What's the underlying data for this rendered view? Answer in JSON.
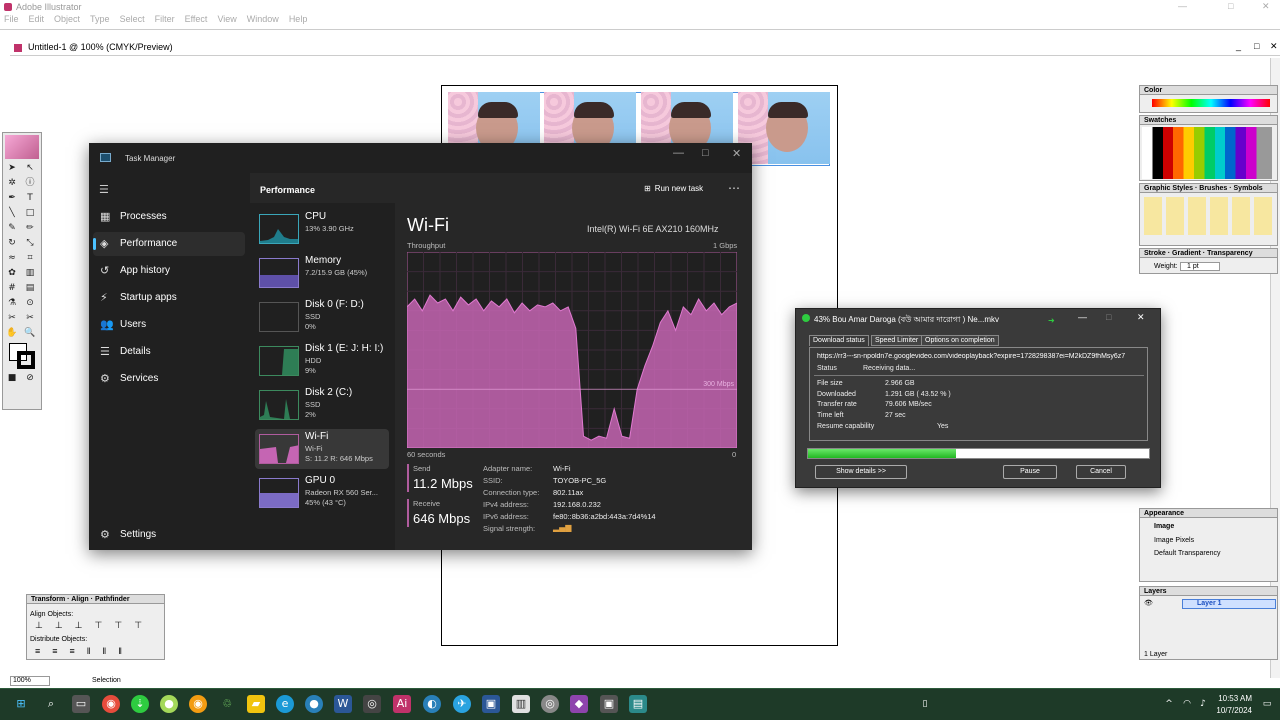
{
  "illustrator": {
    "title": "Adobe Illustrator",
    "menu": [
      "File",
      "Edit",
      "Object",
      "Type",
      "Select",
      "Filter",
      "Effect",
      "View",
      "Window",
      "Help"
    ],
    "doc_tab": "Untitled-1 @ 100% (CMYK/Preview)",
    "zoom": "100%",
    "status_tool": "Selection",
    "panels": {
      "color": "Color",
      "swatches": "Swatches",
      "graphic_styles": "Graphic Styles",
      "brushes": "Brushes",
      "symbols": "Symbols",
      "stroke": "Stroke",
      "gradient": "Gradient",
      "transparency": "Transparency",
      "weight_label": "Weight:",
      "weight_value": "1 pt",
      "appearance": "Appearance",
      "appearance_image": "Image",
      "appearance_pixels": "Image Pixels",
      "appearance_transparency": "Default Transparency",
      "layers": "Layers",
      "layer1": "Layer 1",
      "layer_count": "1 Layer",
      "transform": "Transform",
      "align": "Align",
      "pathfinder": "Pathfinder",
      "align_objects": "Align Objects:",
      "distribute_objects": "Distribute Objects:"
    }
  },
  "task_manager": {
    "title": "Task Manager",
    "section": "Performance",
    "run_new_task": "Run new task",
    "nav": [
      {
        "label": "Processes",
        "icon": "processes-icon"
      },
      {
        "label": "Performance",
        "icon": "performance-icon"
      },
      {
        "label": "App history",
        "icon": "app-history-icon"
      },
      {
        "label": "Startup apps",
        "icon": "startup-apps-icon"
      },
      {
        "label": "Users",
        "icon": "users-icon"
      },
      {
        "label": "Details",
        "icon": "details-icon"
      },
      {
        "label": "Services",
        "icon": "services-icon"
      }
    ],
    "settings": "Settings",
    "resources": [
      {
        "name": "CPU",
        "d1": "13% 3.90 GHz",
        "d2": ""
      },
      {
        "name": "Memory",
        "d1": "7.2/15.9 GB (45%)",
        "d2": ""
      },
      {
        "name": "Disk 0 (F: D:)",
        "d1": "SSD",
        "d2": "0%"
      },
      {
        "name": "Disk 1 (E: J: H: I:)",
        "d1": "HDD",
        "d2": "9%"
      },
      {
        "name": "Disk 2 (C:)",
        "d1": "SSD",
        "d2": "2%"
      },
      {
        "name": "Wi-Fi",
        "d1": "Wi-Fi",
        "d2": "S: 11.2 R: 646 Mbps"
      },
      {
        "name": "GPU 0",
        "d1": "Radeon RX 560 Ser...",
        "d2": "45% (43 °C)"
      }
    ],
    "wifi": {
      "heading": "Wi-Fi",
      "adapter_name_title": "Intel(R) Wi-Fi 6E AX210 160MHz",
      "throughput": "Throughput",
      "max": "1 Gbps",
      "mid_line": "300 Mbps",
      "time_label": "60 seconds",
      "zero": "0",
      "send_label": "Send",
      "send_value": "11.2 Mbps",
      "receive_label": "Receive",
      "receive_value": "646 Mbps",
      "details": [
        {
          "label": "Adapter name:",
          "value": "Wi-Fi"
        },
        {
          "label": "SSID:",
          "value": "TOYOB-PC_5G"
        },
        {
          "label": "Connection type:",
          "value": "802.11ax"
        },
        {
          "label": "IPv4 address:",
          "value": "192.168.0.232"
        },
        {
          "label": "IPv6 address:",
          "value": "fe80::8b36:a2bd:443a:7d4%14"
        },
        {
          "label": "Signal strength:",
          "value": ""
        }
      ],
      "receive_series_mbps": [
        720,
        760,
        700,
        780,
        740,
        760,
        700,
        770,
        730,
        760,
        700,
        750,
        720,
        760,
        690,
        740,
        700,
        730,
        720,
        740,
        700,
        720,
        610,
        60,
        40,
        60,
        50,
        200,
        60,
        50,
        300,
        420,
        520,
        640,
        700,
        600,
        720,
        680,
        760,
        700,
        740,
        680,
        720,
        740
      ]
    }
  },
  "idm": {
    "title": "43% Bou Amar Daroga (বউ আমার দারোগা ) Ne...mkv",
    "tabs": [
      "Download status",
      "Speed Limiter",
      "Options on completion"
    ],
    "url": "https://rr3---sn-npoldn7e.googlevideo.com/videoplayback?expire=1728298387ei=M2kDZ9fhMsy6z7",
    "status_label": "Status",
    "status_value": "Receiving data...",
    "rows": [
      {
        "label": "File size",
        "value": "2.966 GB"
      },
      {
        "label": "Downloaded",
        "value": "1.291 GB ( 43.52 % )"
      },
      {
        "label": "Transfer rate",
        "value": "79.606 MB/sec"
      },
      {
        "label": "Time left",
        "value": "27 sec"
      }
    ],
    "resume_label": "Resume capability",
    "resume_value": "Yes",
    "progress": 0.4352,
    "show_details": "Show details >>",
    "pause": "Pause",
    "cancel": "Cancel"
  },
  "taskbar": {
    "time": "10:53 AM",
    "date": "10/7/2024"
  }
}
